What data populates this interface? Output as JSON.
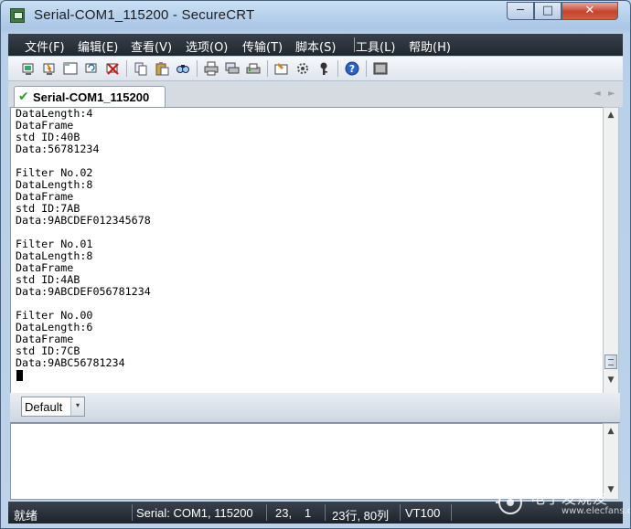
{
  "window": {
    "title": "Serial-COM1_115200 - SecureCRT",
    "min_glyph": "─",
    "max_glyph": "□",
    "close_glyph": "✕"
  },
  "menu": [
    "文件(F)",
    "编辑(E)",
    "查看(V)",
    "选项(O)",
    "传输(T)",
    "脚本(S)",
    "工具(L)",
    "帮助(H)"
  ],
  "toolbar": {
    "icons": [
      "connect-icon",
      "quick-connect-icon",
      "connect-in-tab-icon",
      "reconnect-icon",
      "disconnect-icon",
      "copy-icon",
      "paste-icon",
      "find-icon",
      "print-icon",
      "print-setup-icon",
      "print-screen-icon",
      "session-options-icon",
      "global-options-icon",
      "keymap-icon",
      "help-icon",
      "sftp-icon"
    ],
    "help_glyph": "?"
  },
  "tab": {
    "check_glyph": "✔",
    "label": "Serial-COM1_115200",
    "nav_left": "◄",
    "nav_right": "►"
  },
  "terminal": {
    "lines": [
      "DataLength:4",
      "DataFrame",
      "std ID:40B",
      "Data:56781234",
      "",
      "Filter No.02",
      "DataLength:8",
      "DataFrame",
      "std ID:7AB",
      "Data:9ABCDEF012345678",
      "",
      "Filter No.01",
      "DataLength:8",
      "DataFrame",
      "std ID:4AB",
      "Data:9ABCDEF056781234",
      "",
      "Filter No.00",
      "DataLength:6",
      "DataFrame",
      "std ID:7CB",
      "Data:9ABC56781234"
    ],
    "scroll_up_glyph": "▲",
    "scroll_down_glyph": "▼"
  },
  "button_bar": {
    "selected": "Default",
    "arrow_glyph": "▾"
  },
  "statusbar": {
    "ready": "就绪",
    "connection": "Serial: COM1, 115200",
    "row": "23,",
    "col": "1",
    "size": "23行, 80列",
    "emulation": "VT100"
  },
  "watermark": {
    "text": "电子发烧友",
    "url": "www.elecfans.com"
  },
  "colors": {
    "menubar": "#21272e",
    "statusbar": "#1d232a",
    "terminal_bg": "#ffffff",
    "close_button": "#c5422f",
    "tab_check": "#2aa02a"
  }
}
